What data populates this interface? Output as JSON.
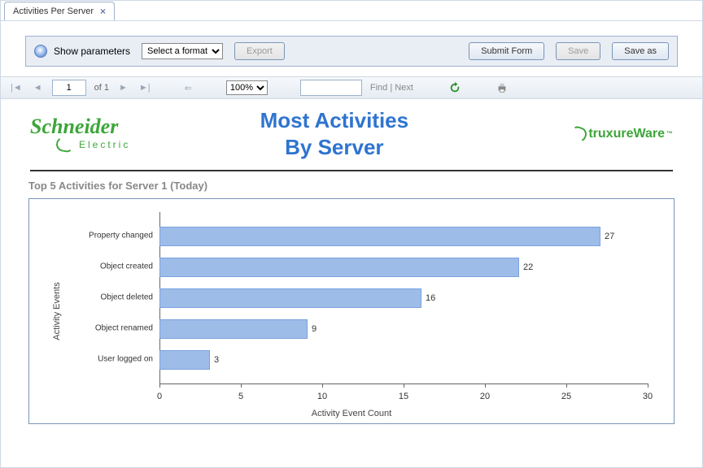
{
  "tab": {
    "title": "Activities Per Server"
  },
  "param_bar": {
    "show_params": "Show parameters",
    "format_placeholder": "Select a format",
    "export": "Export",
    "submit": "Submit Form",
    "save": "Save",
    "save_as": "Save as"
  },
  "viewer": {
    "page_value": "1",
    "page_of": "of 1",
    "zoom": "100%",
    "find_value": "",
    "find_label": "Find | Next"
  },
  "report": {
    "brand": "Schneider",
    "brand_sub": "Electric",
    "title_line1": "Most Activities",
    "title_line2": "By Server",
    "struxure": "truxureWare",
    "section_title": "Top 5 Activities for Server 1 (Today)",
    "xlabel": "Activity Event Count",
    "ylabel": "Activity Events"
  },
  "chart_data": {
    "type": "bar",
    "orientation": "horizontal",
    "categories": [
      "Property changed",
      "Object created",
      "Object deleted",
      "Object renamed",
      "User logged on"
    ],
    "values": [
      27,
      22,
      16,
      9,
      3
    ],
    "xlabel": "Activity Event Count",
    "ylabel": "Activity Events",
    "xlim": [
      0,
      30
    ],
    "xticks": [
      0,
      5,
      10,
      15,
      20,
      25,
      30
    ],
    "title": "Top 5 Activities for Server 1 (Today)"
  },
  "colors": {
    "bar": "#9dbce8",
    "accent": "#2f74d0",
    "brand_green": "#3da639"
  }
}
